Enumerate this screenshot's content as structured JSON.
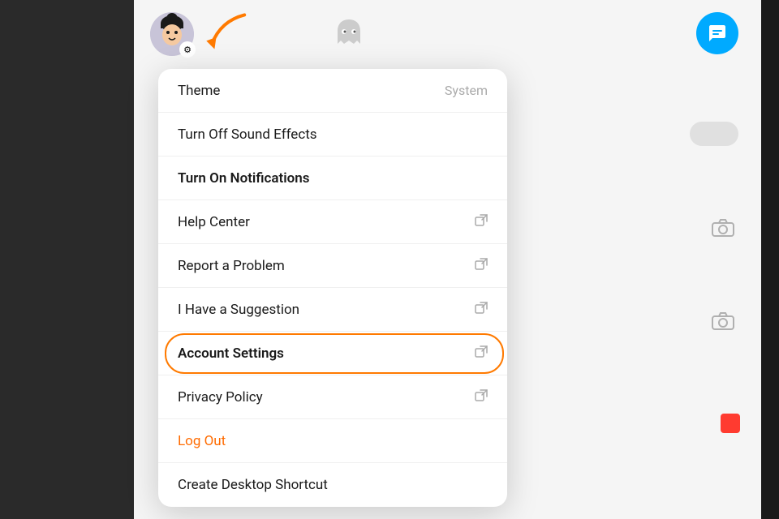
{
  "app": {
    "title": "Snapchat"
  },
  "avatar": {
    "alt": "User avatar with gear settings icon"
  },
  "topbar": {
    "action_button_icon": "↩"
  },
  "menu": {
    "items": [
      {
        "id": "theme",
        "label": "Theme",
        "value": "System",
        "icon": null,
        "bold": false,
        "special": null
      },
      {
        "id": "sound",
        "label": "Turn Off Sound Effects",
        "value": null,
        "icon": null,
        "bold": false,
        "special": null
      },
      {
        "id": "notifications",
        "label": "Turn On Notifications",
        "value": null,
        "icon": null,
        "bold": true,
        "special": null
      },
      {
        "id": "help",
        "label": "Help Center",
        "value": null,
        "icon": "external",
        "bold": false,
        "special": null
      },
      {
        "id": "report",
        "label": "Report a Problem",
        "value": null,
        "icon": "external",
        "bold": false,
        "special": null
      },
      {
        "id": "suggestion",
        "label": "I Have a Suggestion",
        "value": null,
        "icon": "external",
        "bold": false,
        "special": null
      },
      {
        "id": "account",
        "label": "Account Settings",
        "value": null,
        "icon": "external",
        "bold": true,
        "special": "highlighted"
      },
      {
        "id": "privacy",
        "label": "Privacy Policy",
        "value": null,
        "icon": "external",
        "bold": false,
        "special": null
      },
      {
        "id": "logout",
        "label": "Log Out",
        "value": null,
        "icon": null,
        "bold": false,
        "special": "logout"
      },
      {
        "id": "shortcut",
        "label": "Create Desktop Shortcut",
        "value": null,
        "icon": null,
        "bold": false,
        "special": null
      }
    ]
  },
  "icons": {
    "external": "⬡",
    "gear": "⚙",
    "camera": "⊙",
    "arrow": "➜"
  }
}
